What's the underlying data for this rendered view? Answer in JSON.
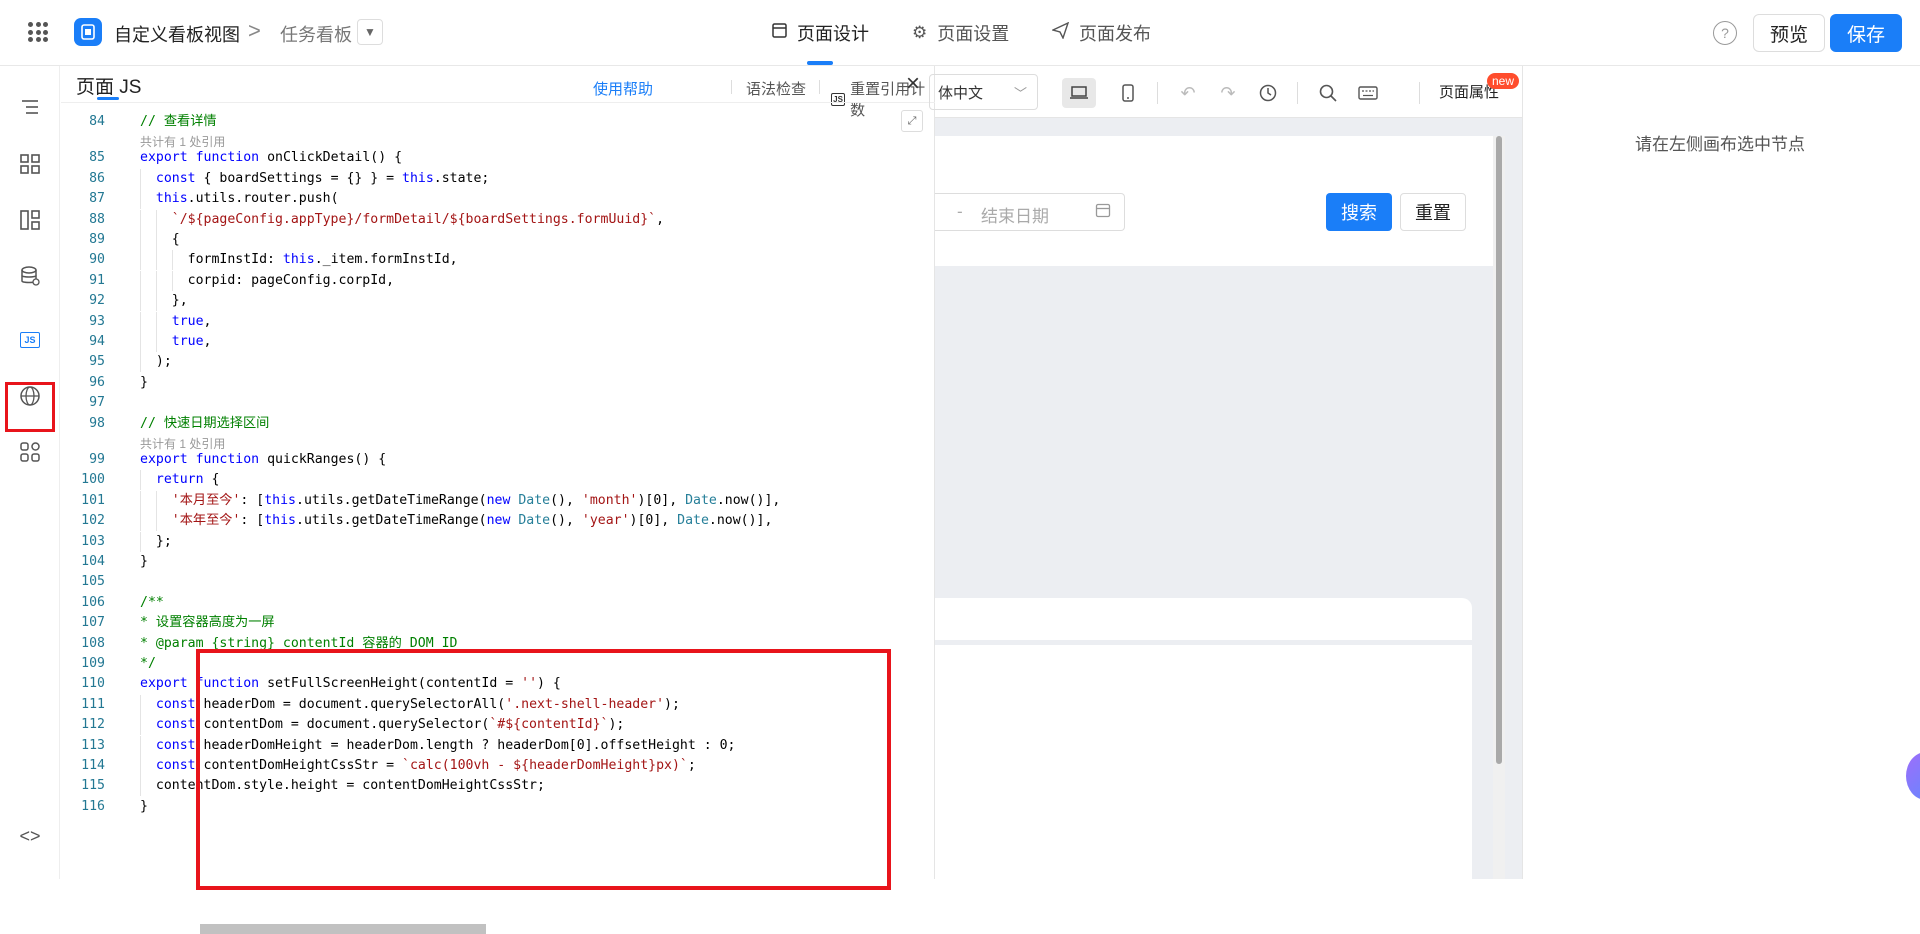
{
  "header": {
    "app_title": "自定义看板视图",
    "breadcrumb_separator": ">",
    "current_page": "任务看板",
    "nav": [
      {
        "label": "页面设计",
        "active": true
      },
      {
        "label": "页面设置",
        "active": false
      },
      {
        "label": "页面发布",
        "active": false
      }
    ],
    "help_icon": "?",
    "preview_label": "预览",
    "save_label": "保存",
    "accent_color": "#1a7ef8"
  },
  "left_sidebar": {
    "items": [
      {
        "icon": "outline-icon"
      },
      {
        "icon": "components-icon"
      },
      {
        "icon": "layout-icon"
      },
      {
        "icon": "datasource-icon"
      },
      {
        "icon": "js-icon",
        "label": "JS",
        "selected": true
      },
      {
        "icon": "globe-icon"
      },
      {
        "icon": "apps-icon"
      },
      {
        "icon": "code-icon",
        "label": "<>"
      }
    ]
  },
  "js_panel": {
    "title": "页面 JS",
    "help_link": "使用帮助",
    "lint_link": "语法检查",
    "reset_link": "重置引用计数",
    "js_badge": "JS",
    "close": "×",
    "ref_hint": "共计有 1 处引用",
    "code_lines": [
      {
        "n": "84",
        "text": "// 查看详情"
      },
      {
        "n": "85",
        "text": "export function onClickDetail() {"
      },
      {
        "n": "86",
        "text": "  const { boardSettings = {} } = this.state;"
      },
      {
        "n": "87",
        "text": "  this.utils.router.push("
      },
      {
        "n": "88",
        "text": "    `/${pageConfig.appType}/formDetail/${boardSettings.formUuid}`,"
      },
      {
        "n": "89",
        "text": "    {"
      },
      {
        "n": "90",
        "text": "      formInstId: this._item.formInstId,"
      },
      {
        "n": "91",
        "text": "      corpid: pageConfig.corpId,"
      },
      {
        "n": "92",
        "text": "    },"
      },
      {
        "n": "93",
        "text": "    true,"
      },
      {
        "n": "94",
        "text": "    true,"
      },
      {
        "n": "95",
        "text": "  );"
      },
      {
        "n": "96",
        "text": "}"
      },
      {
        "n": "97",
        "text": ""
      },
      {
        "n": "98",
        "text": "// 快速日期选择区间"
      },
      {
        "n": "99",
        "text": "export function quickRanges() {"
      },
      {
        "n": "100",
        "text": "  return {"
      },
      {
        "n": "101",
        "text": "    '本月至今': [this.utils.getDateTimeRange(new Date(), 'month')[0], Date.now()],"
      },
      {
        "n": "102",
        "text": "    '本年至今': [this.utils.getDateTimeRange(new Date(), 'year')[0], Date.now()],"
      },
      {
        "n": "103",
        "text": "  };"
      },
      {
        "n": "104",
        "text": "}"
      },
      {
        "n": "105",
        "text": ""
      },
      {
        "n": "106",
        "text": "/**"
      },
      {
        "n": "107",
        "text": "* 设置容器高度为一屏"
      },
      {
        "n": "108",
        "text": "* @param {string} contentId 容器的 DOM ID"
      },
      {
        "n": "109",
        "text": "*/"
      },
      {
        "n": "110",
        "text": "export function setFullScreenHeight(contentId = '') {"
      },
      {
        "n": "111",
        "text": "  const headerDom = document.querySelectorAll('.next-shell-header');"
      },
      {
        "n": "112",
        "text": "  const contentDom = document.querySelector(`#${contentId}`);"
      },
      {
        "n": "113",
        "text": "  const headerDomHeight = headerDom.length ? headerDom[0].offsetHeight : 0;"
      },
      {
        "n": "114",
        "text": "  const contentDomHeightCssStr = `calc(100vh - ${headerDomHeight}px)`;"
      },
      {
        "n": "115",
        "text": "  contentDom.style.height = contentDomHeightCssStr;"
      },
      {
        "n": "116",
        "text": "}"
      }
    ]
  },
  "canvas": {
    "language_select": "体中文",
    "page_props_label": "页面属性",
    "new_badge": "new",
    "date_dash": "-",
    "end_date_placeholder": "结束日期",
    "search_button": "搜索",
    "reset_button": "重置"
  },
  "right_panel": {
    "hint": "请在左侧画布选中节点"
  }
}
